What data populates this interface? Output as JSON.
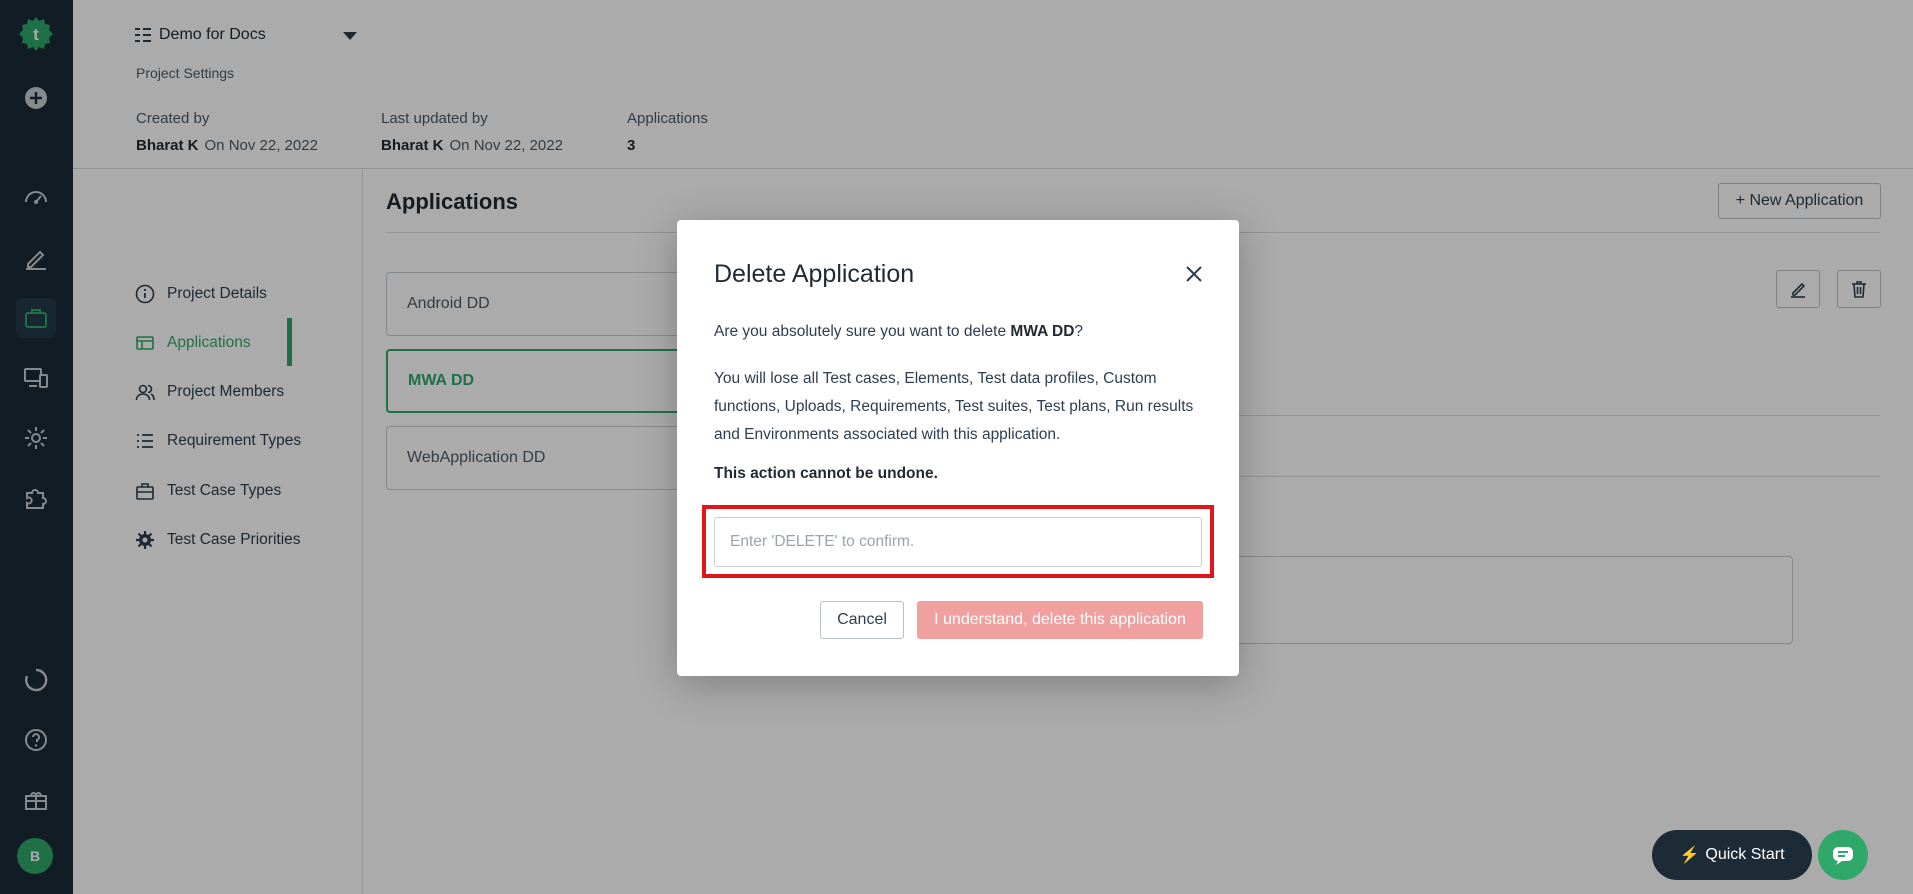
{
  "header": {
    "project_name": "Demo for Docs",
    "breadcrumb": "Project Settings",
    "created_by_label": "Created by",
    "created_by_name": "Bharat K",
    "created_by_date": "On Nov 22, 2022",
    "updated_by_label": "Last updated by",
    "updated_by_name": "Bharat K",
    "updated_by_date": "On Nov 22, 2022",
    "applications_label": "Applications",
    "applications_count": "3"
  },
  "sidebar": {
    "items": [
      {
        "label": "Project Details",
        "icon": "info-icon"
      },
      {
        "label": "Applications",
        "icon": "table-icon",
        "active": true
      },
      {
        "label": "Project Members",
        "icon": "users-icon"
      },
      {
        "label": "Requirement Types",
        "icon": "list-icon"
      },
      {
        "label": "Test Case Types",
        "icon": "briefcase-icon"
      },
      {
        "label": "Test Case Priorities",
        "icon": "gear-icon"
      }
    ]
  },
  "main": {
    "title": "Applications",
    "new_button": "+ New Application",
    "apps": [
      "Android DD",
      "MWA DD",
      "WebApplication DD"
    ],
    "selected_app": "MWA DD"
  },
  "modal": {
    "title": "Delete Application",
    "question_prefix": "Are you absolutely sure you want to delete",
    "app_name": "MWA DD",
    "question_suffix": "?",
    "warning": "You will lose all Test cases, Elements, Test data profiles, Custom functions, Uploads, Requirements, Test suites, Test plans, Run results and Environments associated with this application.",
    "irreversible": "This action cannot be undone.",
    "input_placeholder": "Enter 'DELETE' to confirm.",
    "cancel_label": "Cancel",
    "confirm_label": "I understand, delete this application"
  },
  "footer": {
    "quick_start_label": "Quick Start",
    "avatar_initial": "B"
  },
  "colors": {
    "accent": "#2fa86a",
    "rail": "#1c2b36",
    "danger_disabled": "#f0a09f",
    "highlight": "#e3151a"
  }
}
